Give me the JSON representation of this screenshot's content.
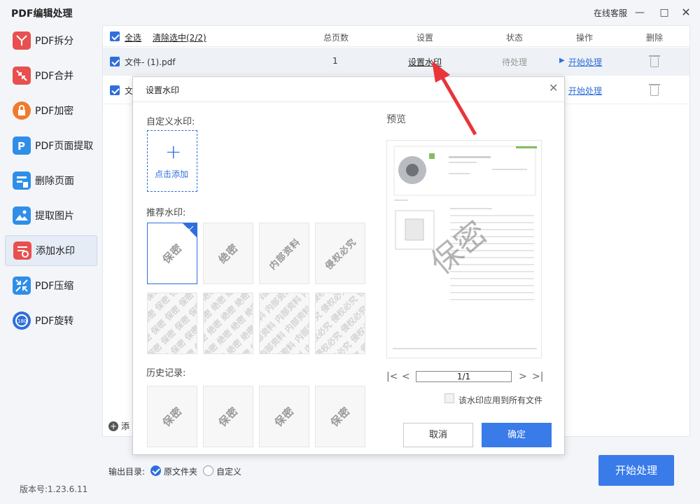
{
  "app": {
    "title": "PDF编辑处理",
    "online_service": "在线客服",
    "version": "版本号:1.23.6.11"
  },
  "sidebar": {
    "items": [
      {
        "label": "PDF拆分",
        "icon": "split-icon",
        "color": "#e8504f"
      },
      {
        "label": "PDF合并",
        "icon": "merge-icon",
        "color": "#e8504f"
      },
      {
        "label": "PDF加密",
        "icon": "lock-icon",
        "color": "#f07b2c"
      },
      {
        "label": "PDF页面提取",
        "icon": "page-extract-icon",
        "color": "#2f8ee8"
      },
      {
        "label": "删除页面",
        "icon": "delete-page-icon",
        "color": "#2f8ee8"
      },
      {
        "label": "提取图片",
        "icon": "image-extract-icon",
        "color": "#2f8ee8"
      },
      {
        "label": "添加水印",
        "icon": "watermark-icon",
        "color": "#e8504f"
      },
      {
        "label": "PDF压缩",
        "icon": "compress-icon",
        "color": "#2f8ee8"
      },
      {
        "label": "PDF旋转",
        "icon": "rotate-icon",
        "color": "#2f6fdc"
      }
    ],
    "active_index": 6
  },
  "table": {
    "select_all": "全选",
    "clear_selection": "清除选中(2/2)",
    "headers": {
      "pages": "总页数",
      "settings": "设置",
      "status": "状态",
      "action": "操作",
      "delete": "删除"
    },
    "rows": [
      {
        "filename": "文件- (1).pdf",
        "pages": "1",
        "settings": "设置水印",
        "status": "待处理",
        "action": "开始处理"
      },
      {
        "filename": "文",
        "action": "开始处理"
      }
    ],
    "add_label": "添"
  },
  "output": {
    "label": "输出目录:",
    "option_original": "原文件夹",
    "option_custom": "自定义",
    "start_button": "开始处理"
  },
  "dialog": {
    "title": "设置水印",
    "custom_label": "自定义水印:",
    "add_label": "点击添加",
    "recommended_label": "推荐水印:",
    "recommended": [
      "保密",
      "绝密",
      "内部资料",
      "侵权必究"
    ],
    "recommended_tiled": [
      "保密",
      "绝密",
      "内部资料",
      "侵权必究"
    ],
    "history_label": "历史记录:",
    "history": [
      "保密",
      "保密",
      "保密",
      "保密"
    ],
    "preview_label": "预览",
    "preview_watermark": "保密",
    "page_indicator": "1/1",
    "apply_all_label": "该水印应用到所有文件",
    "cancel": "取消",
    "confirm": "确定"
  },
  "colors": {
    "accent": "#2f6fdc",
    "primary_button": "#3a7bea",
    "arrow": "#e8353a"
  }
}
